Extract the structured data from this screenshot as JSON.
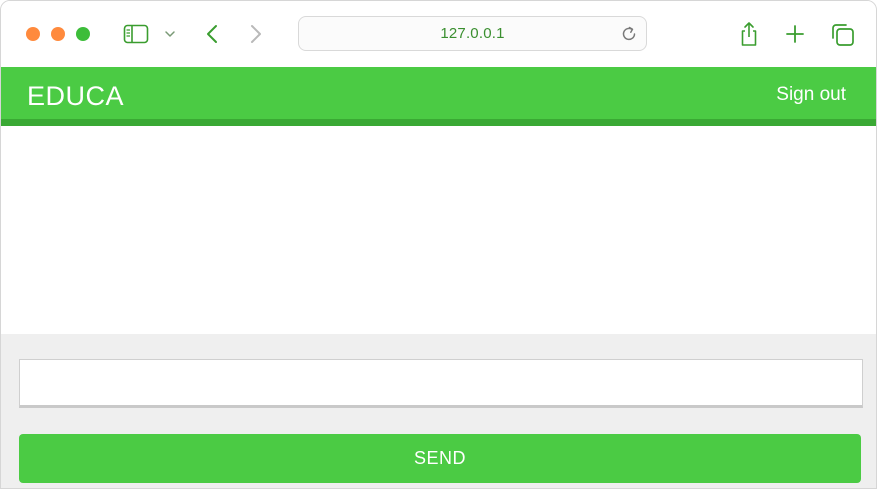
{
  "browser": {
    "address": "127.0.0.1",
    "icons": [
      "sidebar-icon",
      "chevron-down-icon",
      "back-icon",
      "forward-icon",
      "reload-icon",
      "share-icon",
      "new-tab-icon",
      "tabs-overview-icon"
    ]
  },
  "app": {
    "brand": "EDUCA",
    "sign_out_label": "Sign out",
    "accent_color": "#4bcb44"
  },
  "composer": {
    "input_value": "",
    "input_placeholder": "",
    "send_label": "SEND"
  }
}
